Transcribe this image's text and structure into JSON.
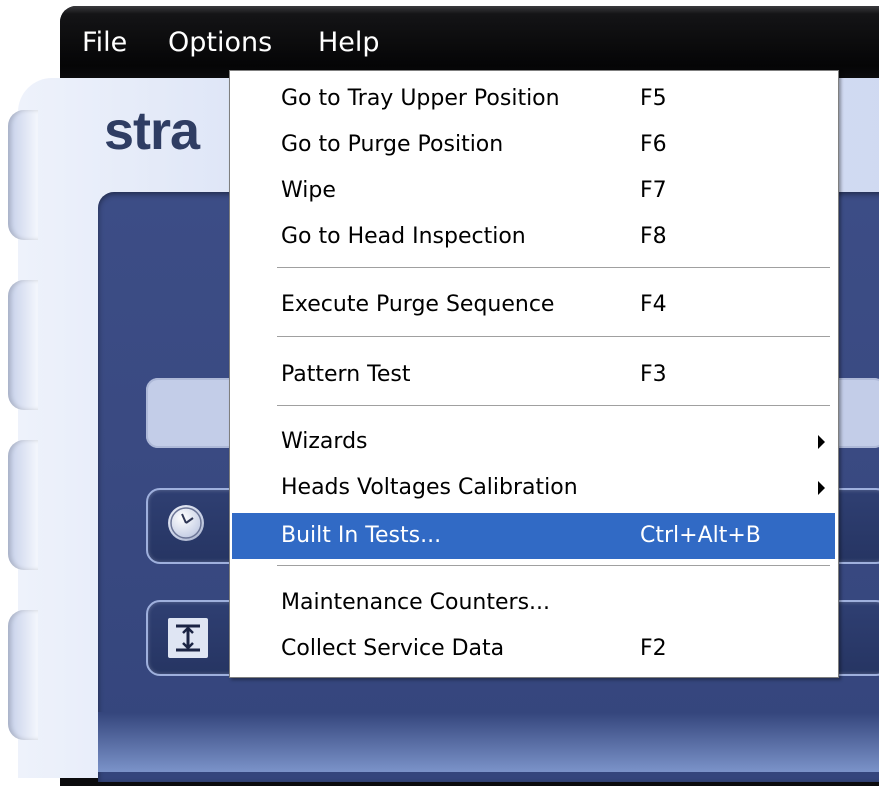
{
  "menubar": {
    "items": [
      {
        "label": "File"
      },
      {
        "label": "Options"
      },
      {
        "label": "Help"
      }
    ]
  },
  "app": {
    "logo_text": "stra"
  },
  "menu": {
    "items": [
      {
        "label": "Go to Tray Upper Position",
        "shortcut": "F5"
      },
      {
        "label": "Go to Purge Position",
        "shortcut": "F6"
      },
      {
        "label": "Wipe",
        "shortcut": "F7"
      },
      {
        "label": "Go to Head Inspection",
        "shortcut": "F8"
      },
      {
        "label": "Execute Purge Sequence",
        "shortcut": "F4"
      },
      {
        "label": "Pattern Test",
        "shortcut": "F3"
      },
      {
        "label": "Wizards",
        "shortcut": "",
        "submenu": true
      },
      {
        "label": "Heads Voltages Calibration",
        "shortcut": "",
        "submenu": true
      },
      {
        "label": "Built In Tests...",
        "shortcut": "Ctrl+Alt+B",
        "selected": true
      },
      {
        "label": "Maintenance Counters...",
        "shortcut": ""
      },
      {
        "label": "Collect Service Data",
        "shortcut": "F2"
      }
    ]
  },
  "icons": {
    "clock": "clock-icon",
    "height": "height-gauge-icon",
    "submenu_arrow": "chevron-right-icon"
  },
  "colors": {
    "menubar_bg": "#0b0b0d",
    "selection": "#316ac5",
    "panel": "#3a4a82",
    "chrome": "#dbe3f6",
    "logo": "#2f3d63"
  }
}
